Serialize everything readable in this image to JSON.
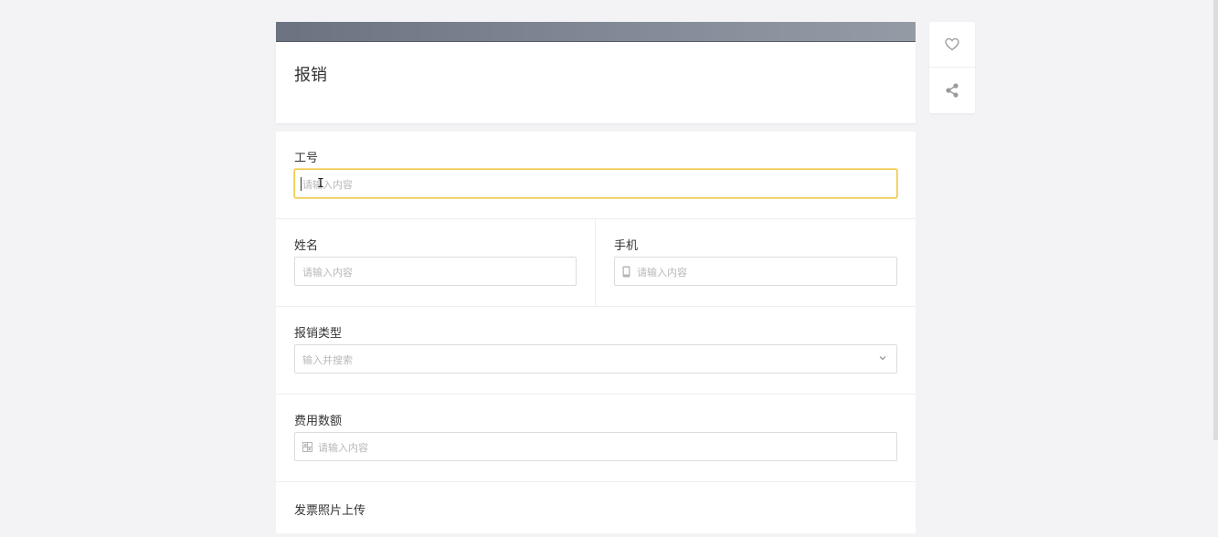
{
  "form": {
    "title": "报销",
    "fields": {
      "employee_id": {
        "label": "工号",
        "placeholder": "请输入内容"
      },
      "name": {
        "label": "姓名",
        "placeholder": "请输入内容"
      },
      "phone": {
        "label": "手机",
        "placeholder": "请输入内容",
        "icon": "phone-icon"
      },
      "type": {
        "label": "报销类型",
        "placeholder": "输入并搜索",
        "icon": "chevron-down-icon"
      },
      "amount": {
        "label": "费用数额",
        "placeholder": "请输入内容",
        "icon": "number-icon"
      },
      "invoice": {
        "label": "发票照片上传"
      }
    }
  },
  "side": {
    "like_icon": "heart-icon",
    "share_icon": "share-icon"
  },
  "colors": {
    "focus_border": "#f2c94c",
    "background": "#f3f3f5"
  }
}
